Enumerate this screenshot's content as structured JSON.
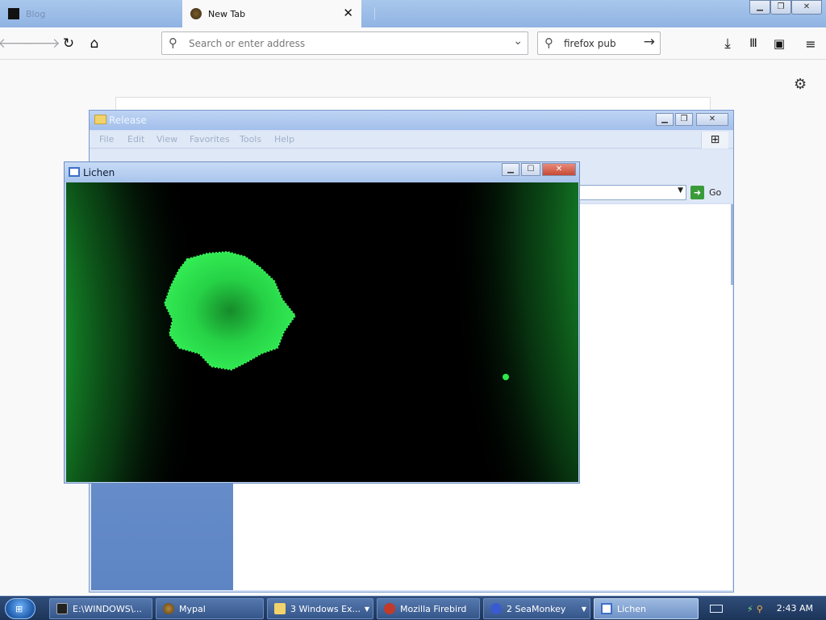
{
  "browser": {
    "tabs": [
      {
        "title": "Blog",
        "active": false
      },
      {
        "title": "New Tab",
        "active": true
      }
    ],
    "urlbar": {
      "placeholder": "Search or enter address",
      "value": ""
    },
    "searchbar": {
      "value": "firefox pub"
    }
  },
  "explorer": {
    "title": "Release",
    "menu": [
      "File",
      "Edit",
      "View",
      "Favorites",
      "Tools",
      "Help"
    ],
    "go_label": "Go"
  },
  "lichen": {
    "title": "Lichen"
  },
  "taskbar": {
    "items": [
      {
        "label": "E:\\WINDOWS\\...",
        "icon": "console-icon",
        "active": false
      },
      {
        "label": "Mypal",
        "icon": "mypal-icon",
        "active": false
      },
      {
        "label": "3 Windows Ex...",
        "icon": "folder-icon",
        "active": false,
        "group": true
      },
      {
        "label": "Mozilla Firebird",
        "icon": "firebird-icon",
        "active": false
      },
      {
        "label": "2 SeaMonkey",
        "icon": "seamonkey-icon",
        "active": false,
        "group": true
      },
      {
        "label": "Lichen",
        "icon": "app-window-icon",
        "active": true
      }
    ],
    "clock": "2:43 AM"
  },
  "colors": {
    "lichen_green": "#2ee84c",
    "tab_bar": "#a9c7ec",
    "taskbar": "#1c3458"
  }
}
